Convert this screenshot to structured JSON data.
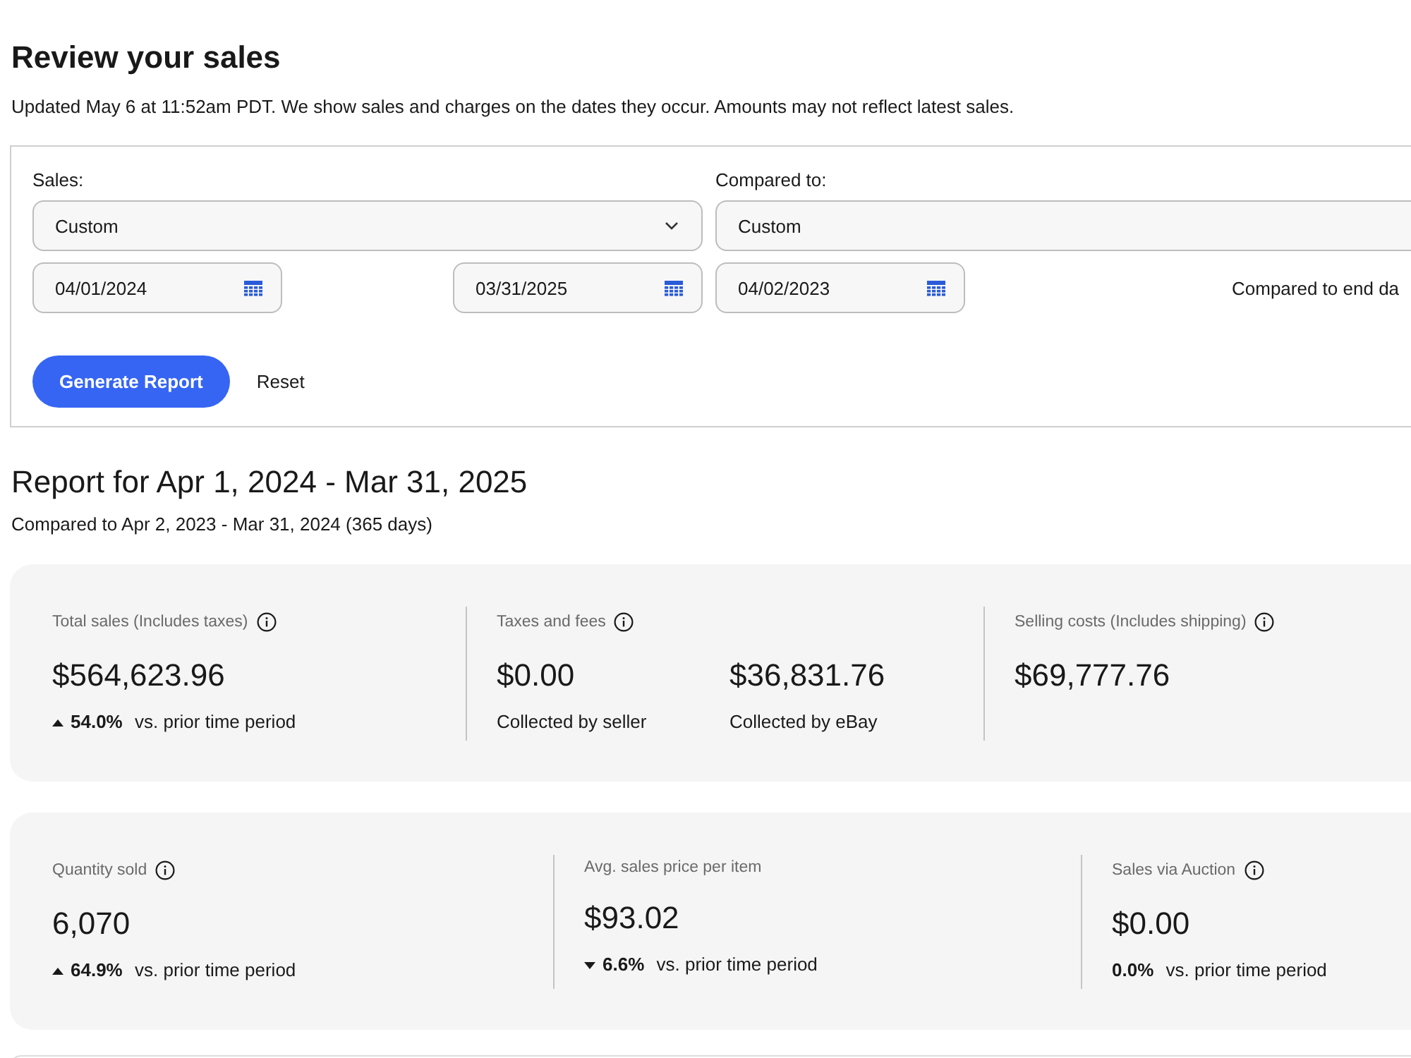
{
  "page": {
    "title": "Review your sales",
    "notice": "Updated May 6 at 11:52am PDT. We show sales and charges on the dates they occur. Amounts may not reflect latest sales."
  },
  "filters": {
    "sales": {
      "label": "Sales:",
      "period": "Custom",
      "start_date": "04/01/2024",
      "end_date": "03/31/2025"
    },
    "compared_to": {
      "label": "Compared to:",
      "period": "Custom",
      "start_date": "04/02/2023",
      "note": "Compared to end da"
    },
    "generate_button": "Generate Report",
    "reset_button": "Reset"
  },
  "report": {
    "title": "Report for Apr 1, 2024 - Mar 31, 2025",
    "subtitle": "Compared to Apr 2, 2023 - Mar 31, 2024 (365 days)"
  },
  "metric_cards": [
    {
      "metrics": [
        {
          "label": "Total sales (Includes taxes)",
          "info": true,
          "figures": [
            {
              "amount": "$564,623.96"
            }
          ],
          "change": {
            "kind": "up",
            "percent": "54.0%",
            "text": "vs. prior time period"
          }
        },
        {
          "label": "Taxes and fees",
          "info": true,
          "figures": [
            {
              "amount": "$0.00",
              "caption": "Collected by seller"
            },
            {
              "amount": "$36,831.76",
              "caption": "Collected by eBay"
            }
          ]
        },
        {
          "label": "Selling costs (Includes shipping)",
          "info": true,
          "figures": [
            {
              "amount": "$69,777.76"
            }
          ]
        }
      ]
    },
    {
      "metrics": [
        {
          "label": "Quantity sold",
          "info": true,
          "figures": [
            {
              "amount": "6,070"
            }
          ],
          "change": {
            "kind": "up",
            "percent": "64.9%",
            "text": "vs. prior time period"
          }
        },
        {
          "label": "Avg. sales price per item",
          "info": false,
          "figures": [
            {
              "amount": "$93.02"
            }
          ],
          "change": {
            "kind": "down",
            "percent": "6.6%",
            "text": "vs. prior time period"
          }
        },
        {
          "label": "Sales via Auction",
          "info": true,
          "figures": [
            {
              "amount": "$0.00"
            }
          ],
          "change": {
            "kind": "flat",
            "percent": "0.0%",
            "text": "vs. prior time period"
          }
        }
      ]
    }
  ]
}
